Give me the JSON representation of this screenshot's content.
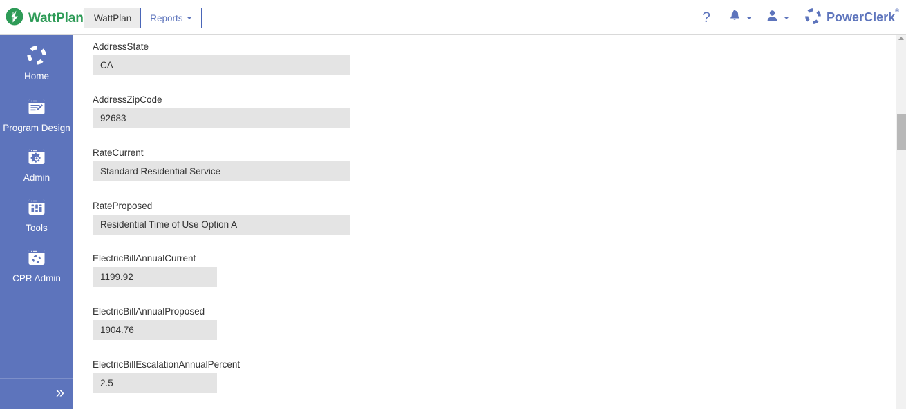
{
  "header": {
    "brand": {
      "name": "WattPlan",
      "trademark": "®",
      "icon": "lightning-bolt-logo"
    },
    "tabs": [
      {
        "label": "WattPlan",
        "active": false,
        "has_caret": false
      },
      {
        "label": "Reports",
        "active": true,
        "has_caret": true
      }
    ],
    "help_icon": "question-mark-icon",
    "help_label": "?",
    "notifications_icon": "bell-icon",
    "account_icon": "user-icon",
    "product": {
      "name": "PowerClerk",
      "trademark": "®",
      "icon": "powerclerk-ring-logo"
    }
  },
  "sidebar": {
    "items": [
      {
        "label": "Home",
        "icon": "ring-logo-icon"
      },
      {
        "label": "Program Design",
        "icon": "window-pencil-icon"
      },
      {
        "label": "Admin",
        "icon": "window-gear-icon"
      },
      {
        "label": "Tools",
        "icon": "window-sliders-icon"
      },
      {
        "label": "CPR Admin",
        "icon": "window-ring-icon"
      }
    ],
    "expand_label": "»",
    "expand_icon": "chevron-double-right-icon"
  },
  "form": {
    "fields": [
      {
        "label": "AddressState",
        "value": "CA",
        "size": "wide"
      },
      {
        "label": "AddressZipCode",
        "value": "92683",
        "size": "wide"
      },
      {
        "label": "RateCurrent",
        "value": "Standard Residential Service",
        "size": "wide"
      },
      {
        "label": "RateProposed",
        "value": "Residential Time of Use Option A",
        "size": "wide"
      },
      {
        "label": "ElectricBillAnnualCurrent",
        "value": "1199.92",
        "size": "narrow"
      },
      {
        "label": "ElectricBillAnnualProposed",
        "value": "1904.76",
        "size": "narrow"
      },
      {
        "label": "ElectricBillEscalationAnnualPercent",
        "value": "2.5",
        "size": "narrow"
      }
    ]
  },
  "colors": {
    "sidebar_blue": "#5d74bc",
    "brand_green": "#2e9b57",
    "field_bg": "#e4e4e4",
    "accent": "#5d74bc"
  }
}
